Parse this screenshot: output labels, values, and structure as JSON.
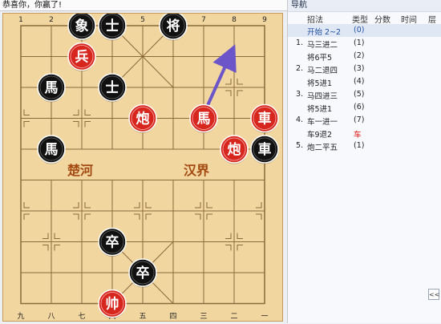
{
  "window": {
    "title": "恭喜你，你赢了!"
  },
  "board": {
    "top_labels": [
      "1",
      "2",
      "3",
      "4",
      "5",
      "6",
      "7",
      "8",
      "9"
    ],
    "bottom_labels": [
      "九",
      "八",
      "七",
      "六",
      "五",
      "四",
      "三",
      "二",
      "一"
    ],
    "river_left": "楚河",
    "river_right": "汉界",
    "line_color": "#8b6a3b",
    "arrow_color": "#6b55c9"
  },
  "pieces": [
    {
      "name": "black-elephant",
      "char": "象",
      "side": "black",
      "file": 2,
      "rank": 0
    },
    {
      "name": "black-advisor-top",
      "char": "士",
      "side": "black",
      "file": 3,
      "rank": 0
    },
    {
      "name": "black-general",
      "char": "将",
      "side": "black",
      "file": 5,
      "rank": 0
    },
    {
      "name": "red-soldier",
      "char": "兵",
      "side": "red",
      "file": 2,
      "rank": 1
    },
    {
      "name": "black-horse-left",
      "char": "馬",
      "side": "black",
      "file": 1,
      "rank": 2
    },
    {
      "name": "black-advisor-mid",
      "char": "士",
      "side": "black",
      "file": 3,
      "rank": 2
    },
    {
      "name": "red-cannon-center",
      "char": "炮",
      "side": "red",
      "file": 4,
      "rank": 3
    },
    {
      "name": "red-horse",
      "char": "馬",
      "side": "red",
      "file": 6,
      "rank": 3
    },
    {
      "name": "red-chariot",
      "char": "車",
      "side": "red",
      "file": 8,
      "rank": 3
    },
    {
      "name": "black-horse-lower",
      "char": "馬",
      "side": "black",
      "file": 1,
      "rank": 4
    },
    {
      "name": "red-cannon-right",
      "char": "炮",
      "side": "red",
      "file": 7,
      "rank": 4
    },
    {
      "name": "black-chariot",
      "char": "車",
      "side": "black",
      "file": 8,
      "rank": 4
    },
    {
      "name": "black-pawn-1",
      "char": "卒",
      "side": "black",
      "file": 3,
      "rank": 7
    },
    {
      "name": "black-pawn-2",
      "char": "卒",
      "side": "black",
      "file": 4,
      "rank": 8
    },
    {
      "name": "red-king",
      "char": "帅",
      "side": "red",
      "file": 3,
      "rank": 9
    }
  ],
  "arrow": {
    "from": {
      "file": 6,
      "rank": 3
    },
    "to": {
      "file": 7,
      "rank": 1
    }
  },
  "navigation": {
    "title": "导航",
    "headers": {
      "move": "招法",
      "type": "类型",
      "score": "分数",
      "time": "时间",
      "layer": "层"
    },
    "rows": [
      {
        "num": "",
        "move": "开始 2~2",
        "type": "(0)",
        "selected": true,
        "red": false
      },
      {
        "num": "1.",
        "move": "马三进二",
        "type": "(1)",
        "selected": false,
        "red": false
      },
      {
        "num": "",
        "move": "将6平5",
        "type": "(2)",
        "selected": false,
        "red": false
      },
      {
        "num": "2.",
        "move": "马二退四",
        "type": "(3)",
        "selected": false,
        "red": false
      },
      {
        "num": "",
        "move": "将5进1",
        "type": "(4)",
        "selected": false,
        "red": false
      },
      {
        "num": "3.",
        "move": "马四进三",
        "type": "(5)",
        "selected": false,
        "red": false
      },
      {
        "num": "",
        "move": "将5进1",
        "type": "(6)",
        "selected": false,
        "red": false
      },
      {
        "num": "4.",
        "move": "车一进一",
        "type": "(7)",
        "selected": false,
        "red": false
      },
      {
        "num": "",
        "move": "车9退2",
        "type": "车",
        "selected": false,
        "red": true
      },
      {
        "num": "5.",
        "move": "炮二平五",
        "type": "(1)",
        "selected": false,
        "red": false
      }
    ],
    "scroll_button": "<<"
  }
}
